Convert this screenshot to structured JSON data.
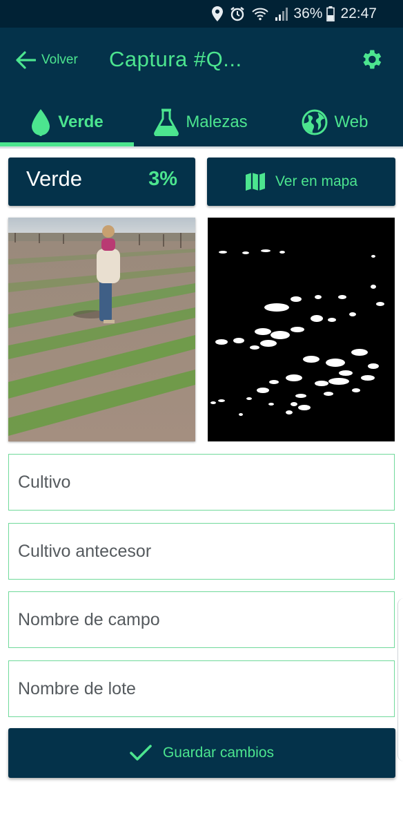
{
  "status_bar": {
    "battery": "36%",
    "time": "22:47",
    "icons": [
      "location-icon",
      "alarm-icon",
      "wifi-icon",
      "signal-icon",
      "battery-icon"
    ]
  },
  "app_bar": {
    "back_label": "Volver",
    "title": "Captura #Q...",
    "settings_icon": "gear-icon"
  },
  "tabs": [
    {
      "label": "Verde",
      "icon": "leaf-icon",
      "active": true
    },
    {
      "label": "Malezas",
      "icon": "flask-icon",
      "active": false
    },
    {
      "label": "Web",
      "icon": "globe-icon",
      "active": false
    }
  ],
  "summary": {
    "label": "Verde",
    "percent": "3%"
  },
  "map_button": {
    "label": "Ver en mapa",
    "icon": "map-icon"
  },
  "images": {
    "photo": "field-photo",
    "mask": "green-cover-mask"
  },
  "form": {
    "fields": [
      {
        "placeholder": "Cultivo"
      },
      {
        "placeholder": "Cultivo antecesor"
      },
      {
        "placeholder": "Nombre de campo"
      },
      {
        "placeholder": "Nombre de lote"
      }
    ]
  },
  "save_button": {
    "label": "Guardar cambios",
    "icon": "check-icon"
  },
  "colors": {
    "primary": "#04324a",
    "accent": "#4ce58f",
    "status_bar": "#012235",
    "field_border": "#6fd99a"
  }
}
